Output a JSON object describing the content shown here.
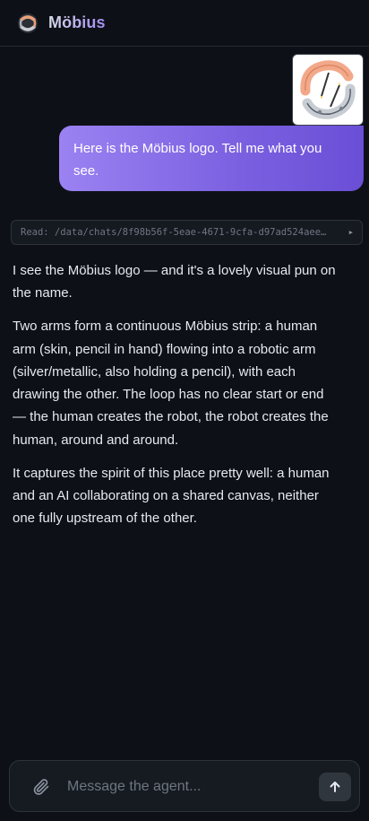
{
  "header": {
    "title": "Möbius",
    "logo_icon": "mobius-logo-icon"
  },
  "chat": {
    "user_message": {
      "attachment_icon": "mobius-logo-image",
      "text": "Here is the Möbius logo. Tell me what you see."
    },
    "tool_call": {
      "text": "Read: /data/chats/8f98b56f-5eae-4671-9cfa-d97ad524aee…",
      "chevron_icon": "chevron-right-icon"
    },
    "assistant_message": {
      "paragraphs": [
        "I see the Möbius logo — and it's a lovely visual pun on the name.",
        "Two arms form a continuous Möbius strip: a human arm (skin, pencil in hand) flowing into a robotic arm (silver/metallic, also holding a pencil), with each drawing the other. The loop has no clear start or end — the human creates the robot, the robot creates the human, around and around.",
        "It captures the spirit of this place pretty well: a human and an AI collaborating on a shared canvas, neither one fully upstream of the other."
      ]
    }
  },
  "composer": {
    "placeholder": "Message the agent...",
    "value": "",
    "attach_icon": "paperclip-icon",
    "send_icon": "arrow-up-icon"
  },
  "colors": {
    "background": "#0d1117",
    "accent_start": "#9b82f2",
    "accent_end": "#6a4fd6",
    "surface": "#161b22"
  }
}
